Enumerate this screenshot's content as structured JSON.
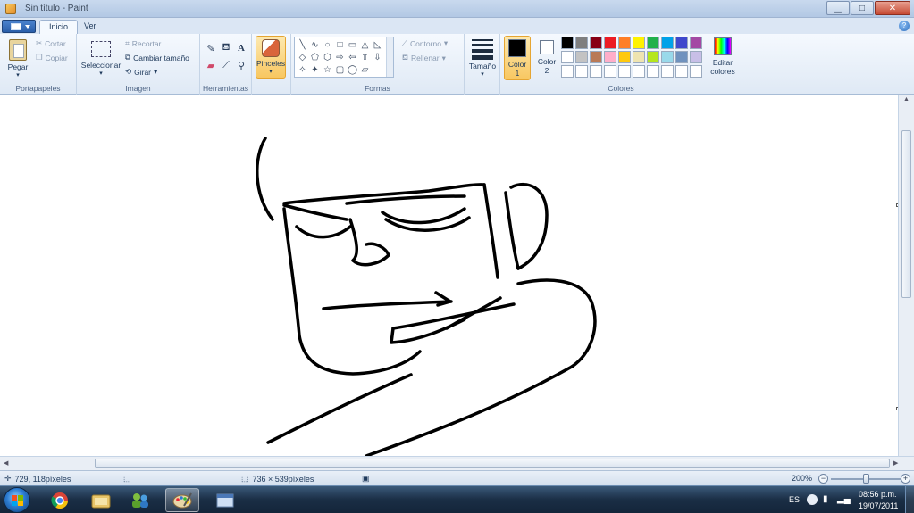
{
  "window": {
    "title": "Sin título - Paint",
    "controls": {
      "minimize": "▁",
      "maximize": "□",
      "close": "✕"
    }
  },
  "tabs": [
    {
      "label": "Inicio",
      "active": true
    },
    {
      "label": "Ver",
      "active": false
    }
  ],
  "ribbon": {
    "clipboard": {
      "label": "Portapapeles",
      "paste": "Pegar",
      "cut": "Cortar",
      "copy": "Copiar"
    },
    "image": {
      "label": "Imagen",
      "select": "Seleccionar",
      "crop": "Recortar",
      "resize": "Cambiar tamaño",
      "rotate": "Girar"
    },
    "tools": {
      "label": "Herramientas",
      "text_glyph": "A"
    },
    "brushes": {
      "label": "Pinceles"
    },
    "shapes": {
      "label": "Formas",
      "outline": "Contorno",
      "fill": "Rellenar",
      "glyphs": [
        "╲",
        "∿",
        "○",
        "□",
        "▭",
        "△",
        "◺",
        "◇",
        "⬠",
        "⬡",
        "⇨",
        "⇦",
        "⇧",
        "⇩",
        "✧",
        "✦",
        "☆",
        "▢",
        "◯",
        "▱"
      ]
    },
    "size": {
      "label": "Tamaño"
    },
    "colors": {
      "label": "Colores",
      "color1_line1": "Color",
      "color1_line2": "1",
      "color2_line1": "Color",
      "color2_line2": "2",
      "edit_line1": "Editar",
      "edit_line2": "colores",
      "color1": "#000000",
      "color2": "#ffffff",
      "palette": [
        [
          "#000000",
          "#7f7f7f",
          "#880015",
          "#ed1c24",
          "#ff7f27",
          "#fff200",
          "#22b14c",
          "#00a2e8",
          "#3f48cc",
          "#a349a4"
        ],
        [
          "#ffffff",
          "#c3c3c3",
          "#b97a57",
          "#ffaec9",
          "#ffc90e",
          "#efe4b0",
          "#b5e61d",
          "#99d9ea",
          "#7092be",
          "#c8bfe7"
        ],
        [
          "#ffffff",
          "#ffffff",
          "#ffffff",
          "#ffffff",
          "#ffffff",
          "#ffffff",
          "#ffffff",
          "#ffffff",
          "#ffffff",
          "#ffffff"
        ]
      ]
    }
  },
  "status": {
    "cursor_pos": "729, 118píxeles",
    "image_size": "736 × 539píxeles",
    "zoom": "200%"
  },
  "taskbar": {
    "lang": "ES",
    "time": "08:56 p.m.",
    "date": "19/07/2011"
  }
}
